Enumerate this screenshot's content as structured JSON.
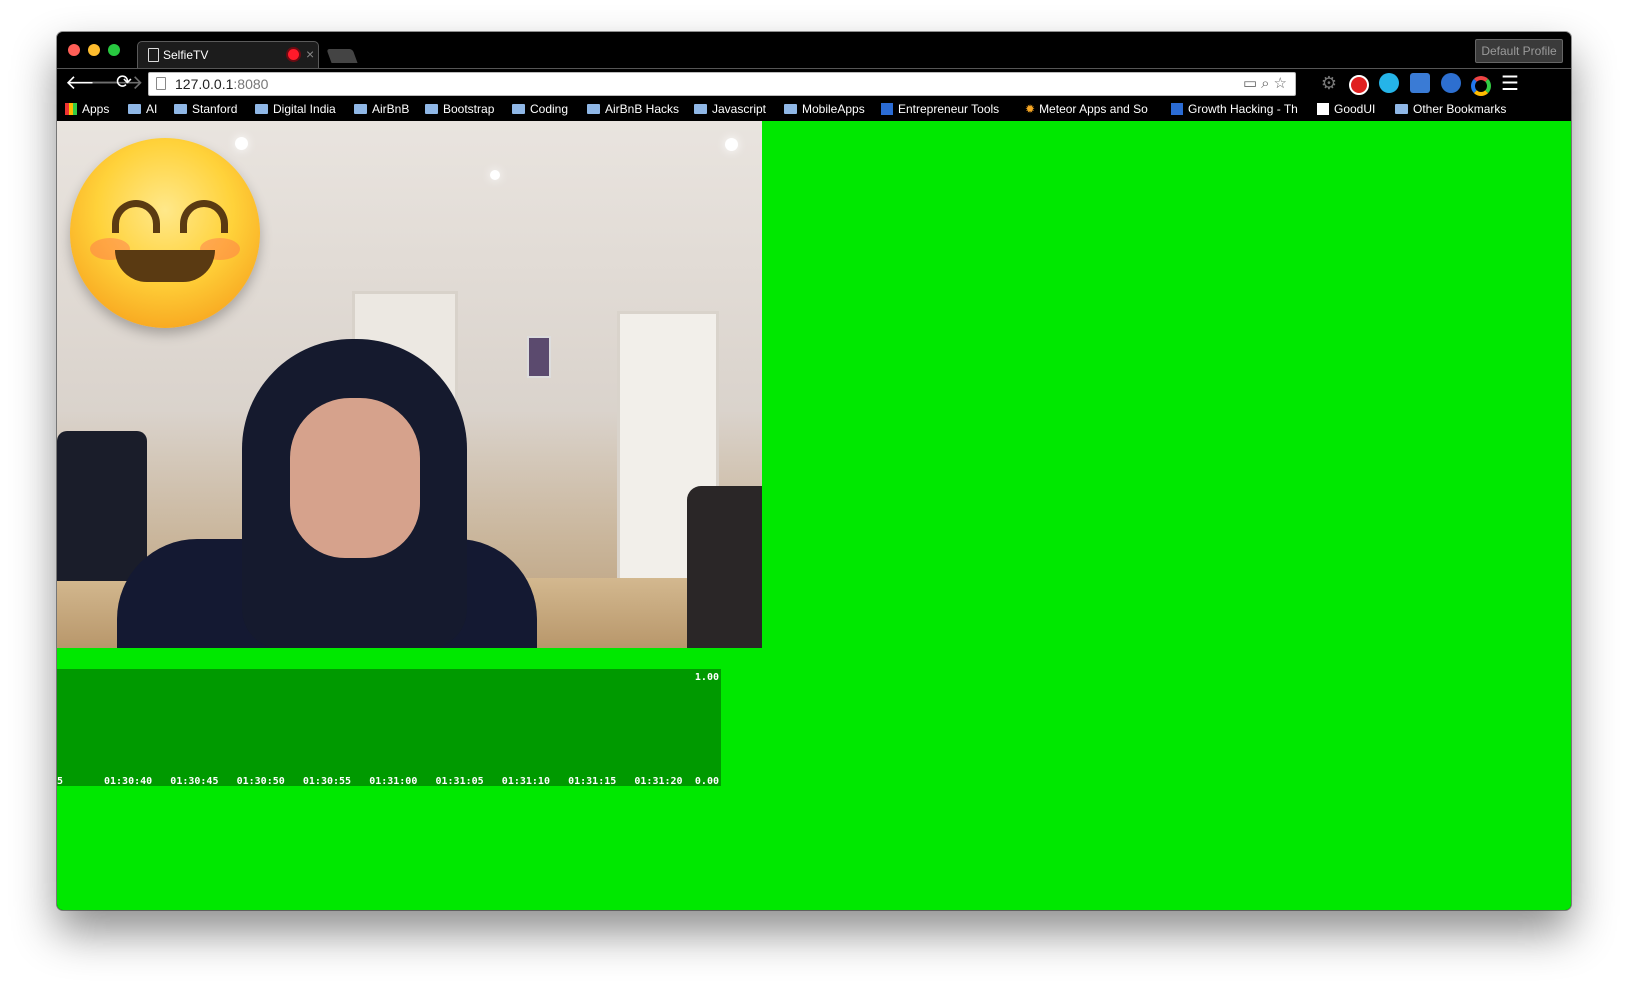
{
  "window": {
    "tab_title": "SelfieTV",
    "profile_button": "Default Profile"
  },
  "toolbar": {
    "url_host": "127.0.0.1",
    "url_port": ":8080"
  },
  "bookmarks": [
    {
      "label": "Apps",
      "icon": "apps-grid-icon"
    },
    {
      "label": "AI",
      "icon": "folder-icon"
    },
    {
      "label": "Stanford",
      "icon": "folder-icon"
    },
    {
      "label": "Digital India",
      "icon": "folder-icon"
    },
    {
      "label": "AirBnB",
      "icon": "folder-icon"
    },
    {
      "label": "Bootstrap",
      "icon": "folder-icon"
    },
    {
      "label": "Coding",
      "icon": "folder-icon"
    },
    {
      "label": "AirBnB Hacks",
      "icon": "folder-icon"
    },
    {
      "label": "Javascript",
      "icon": "folder-icon"
    },
    {
      "label": "MobileApps",
      "icon": "folder-icon"
    },
    {
      "label": "Entrepreneur Tools",
      "icon": "trello-icon"
    },
    {
      "label": "Meteor Apps and So",
      "icon": "meteor-icon"
    },
    {
      "label": "Growth Hacking - Th",
      "icon": "growth-icon"
    },
    {
      "label": "GoodUI",
      "icon": "goodui-icon"
    },
    {
      "label": "Other Bookmarks",
      "icon": "folder-icon"
    }
  ],
  "colors": {
    "background_green": "#00e800",
    "chart_bg": "#009a00"
  },
  "chart_data": {
    "type": "line",
    "x_ticks": [
      "5",
      "01:30:40",
      "01:30:45",
      "01:30:50",
      "01:30:55",
      "01:31:00",
      "01:31:05",
      "01:31:10",
      "01:31:15",
      "01:31:20"
    ],
    "y_max_label": "1.00",
    "y_min_label": "0.00",
    "ylim": [
      0,
      1
    ],
    "series": []
  }
}
